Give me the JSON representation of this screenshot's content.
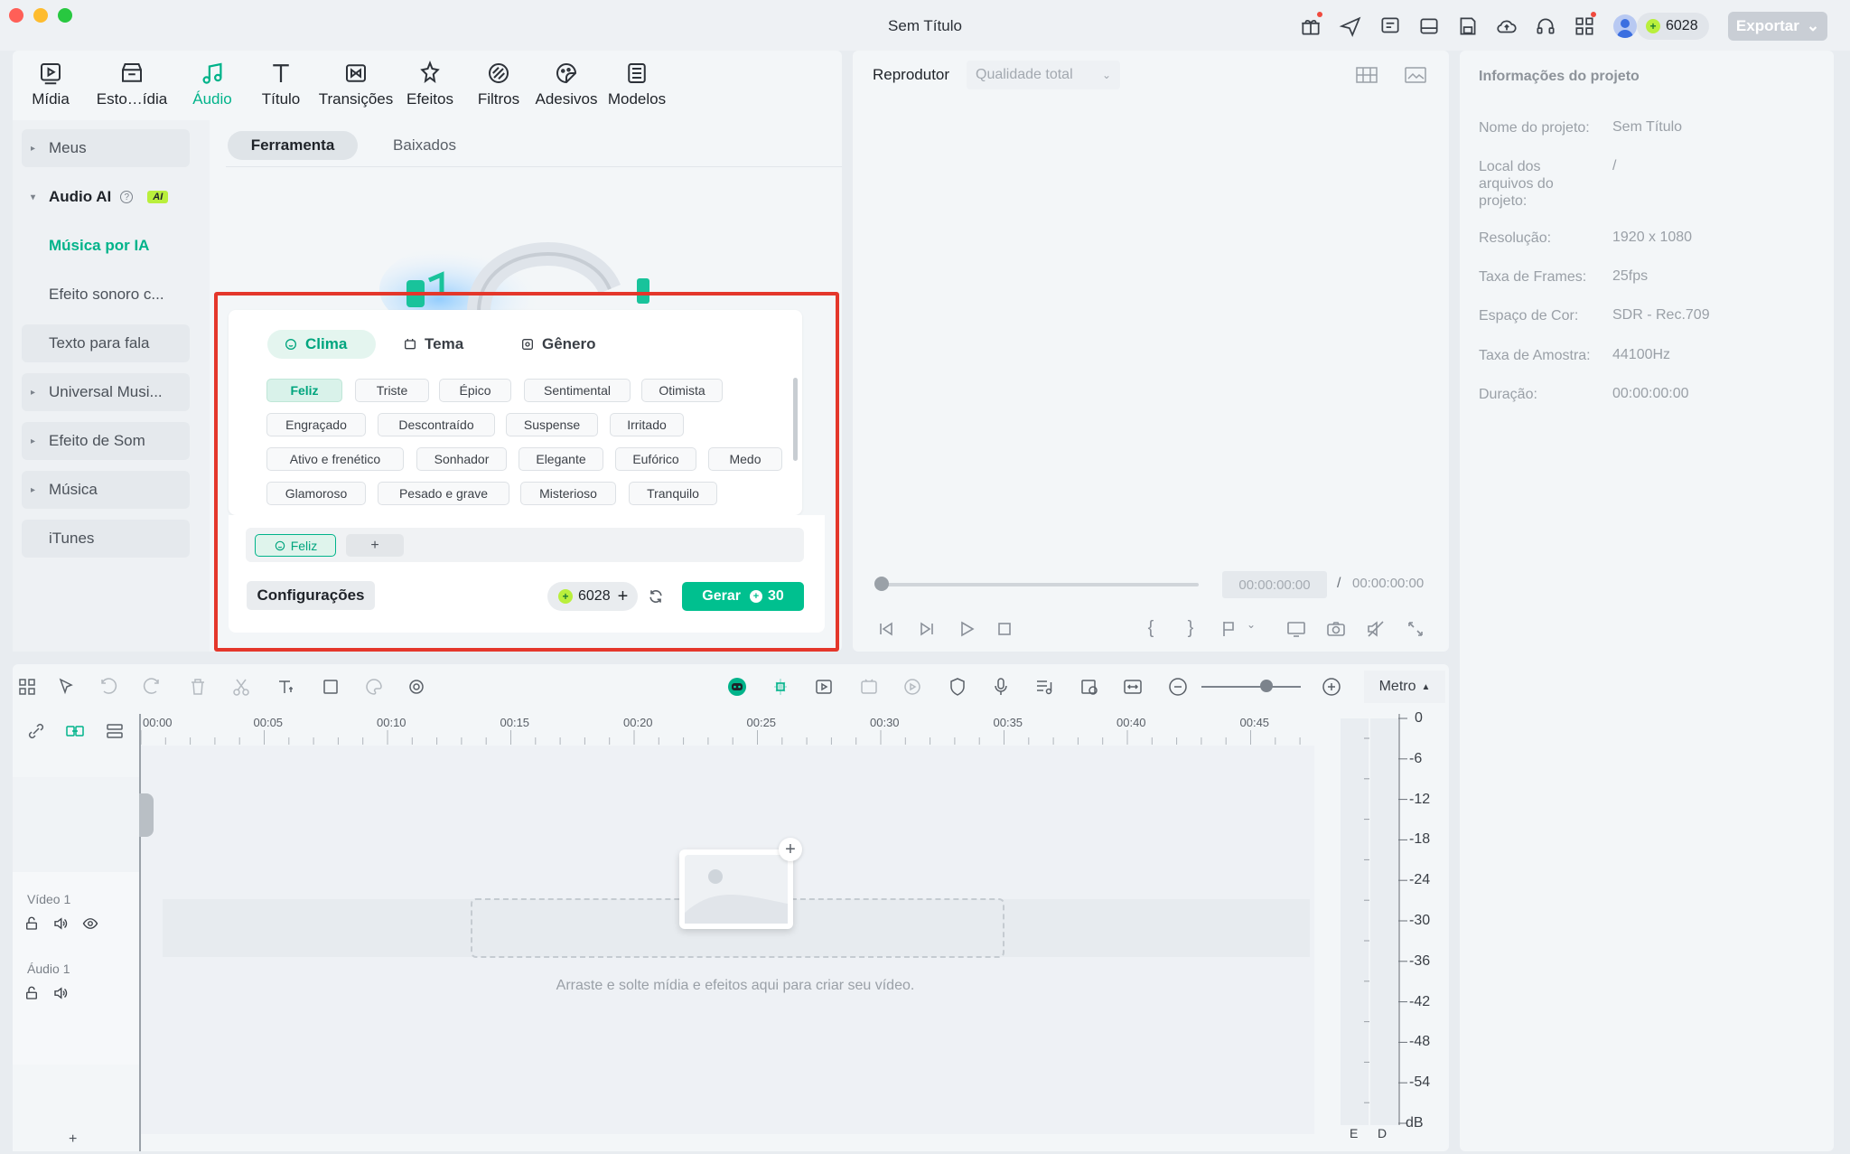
{
  "window": {
    "title": "Sem Título"
  },
  "header": {
    "credits": "6028",
    "export_label": "Exportar"
  },
  "nav": {
    "items": [
      {
        "label": "Mídia",
        "icon": "media-icon"
      },
      {
        "label": "Esto…ídia",
        "icon": "stock-media-icon"
      },
      {
        "label": "Áudio",
        "icon": "music-note-icon",
        "active": true
      },
      {
        "label": "Título",
        "icon": "title-icon"
      },
      {
        "label": "Transições",
        "icon": "transitions-icon"
      },
      {
        "label": "Efeitos",
        "icon": "effects-icon"
      },
      {
        "label": "Filtros",
        "icon": "filters-icon"
      },
      {
        "label": "Adesivos",
        "icon": "stickers-icon"
      },
      {
        "label": "Modelos",
        "icon": "templates-icon"
      }
    ]
  },
  "sidebar": {
    "items": [
      {
        "label": "Meus"
      },
      {
        "label": "Audio AI",
        "badge": "AI"
      },
      {
        "label": "Música por IA"
      },
      {
        "label": "Efeito sonoro c..."
      },
      {
        "label": "Texto para fala"
      },
      {
        "label": "Universal Musi..."
      },
      {
        "label": "Efeito de Som"
      },
      {
        "label": "Música"
      },
      {
        "label": "iTunes"
      }
    ]
  },
  "content_tabs": {
    "tool": "Ferramenta",
    "downloaded": "Baixados"
  },
  "ai_music": {
    "category_tabs": {
      "mood": "Clima",
      "theme": "Tema",
      "genre": "Gênero"
    },
    "chips": [
      "Feliz",
      "Triste",
      "Épico",
      "Sentimental",
      "Otimista",
      "Engraçado",
      "Descontraído",
      "Suspense",
      "Irritado",
      "Ativo e frenético",
      "Sonhador",
      "Elegante",
      "Eufórico",
      "Medo",
      "Glamoroso",
      "Pesado e grave",
      "Misterioso",
      "Tranquilo"
    ],
    "selected_chip": "Feliz",
    "add_label": "+",
    "config_label": "Configurações",
    "credits": "6028",
    "generate_label": "Gerar",
    "generate_cost": "30"
  },
  "viewer": {
    "label": "Reprodutor",
    "quality": "Qualidade total",
    "time_current": "00:00:00:00",
    "time_sep": "/",
    "time_total": "00:00:00:00"
  },
  "info": {
    "title": "Informações do projeto",
    "rows": [
      {
        "label": "Nome do projeto:",
        "value": "Sem Título"
      },
      {
        "label": "Local dos arquivos do projeto:",
        "value": "/"
      },
      {
        "label": "Resolução:",
        "value": "1920 x 1080"
      },
      {
        "label": "Taxa de Frames:",
        "value": "25fps"
      },
      {
        "label": "Espaço de Cor:",
        "value": "SDR - Rec.709"
      },
      {
        "label": "Taxa de Amostra:",
        "value": "44100Hz"
      },
      {
        "label": "Duração:",
        "value": "00:00:00:00"
      }
    ]
  },
  "timeline": {
    "metro_label": "Metro",
    "ruler": [
      "00:00",
      "00:05",
      "00:10",
      "00:15",
      "00:20",
      "00:25",
      "00:30",
      "00:35",
      "00:40",
      "00:45"
    ],
    "video_track": "Vídeo 1",
    "audio_track": "Áudio 1",
    "drop_text": "Arraste e solte mídia e efeitos aqui para criar seu vídeo.",
    "add_track": "+"
  },
  "meter": {
    "labels": [
      "0",
      "-6",
      "-12",
      "-18",
      "-24",
      "-30",
      "-36",
      "-42",
      "-48",
      "-54",
      "dB"
    ],
    "channels": [
      "E",
      "D"
    ]
  },
  "colors": {
    "accent": "#00b38a",
    "generate": "#00c08f",
    "highlight": "#e4372b"
  }
}
